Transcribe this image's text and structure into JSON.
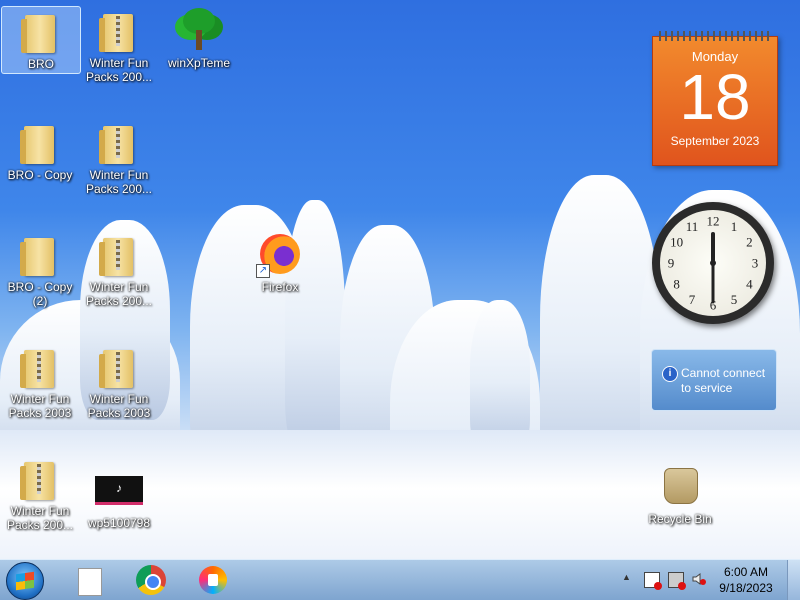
{
  "desktop": {
    "icons": [
      {
        "label": "BRO"
      },
      {
        "label": "Winter Fun Packs 200..."
      },
      {
        "label": "winXpTeme"
      },
      {
        "label": "BRO - Copy"
      },
      {
        "label": "Winter Fun Packs 200..."
      },
      {
        "label": "BRO - Copy (2)"
      },
      {
        "label": "Winter Fun Packs 200..."
      },
      {
        "label": "Firefox"
      },
      {
        "label": "Winter Fun Packs 2003"
      },
      {
        "label": "Winter Fun Packs 2003"
      },
      {
        "label": "Winter Fun Packs 200..."
      },
      {
        "label": "wp5100798"
      },
      {
        "label": "Recycle Bin"
      }
    ],
    "tiktok_glyph": "♪"
  },
  "gadgets": {
    "calendar": {
      "day": "Monday",
      "date": "18",
      "month_year": "September 2023"
    },
    "clock": {
      "numerals": [
        "12",
        "1",
        "2",
        "3",
        "4",
        "5",
        "6",
        "7",
        "8",
        "9",
        "10",
        "11"
      ]
    },
    "notice": {
      "icon": "i",
      "message": "Cannot connect to service"
    }
  },
  "taskbar": {
    "time": "6:00 AM",
    "date": "9/18/2023",
    "tray_arrow": "▲"
  },
  "colors": {
    "calendar_orange": "#e0541d",
    "taskbar": "#9ec0e3"
  }
}
